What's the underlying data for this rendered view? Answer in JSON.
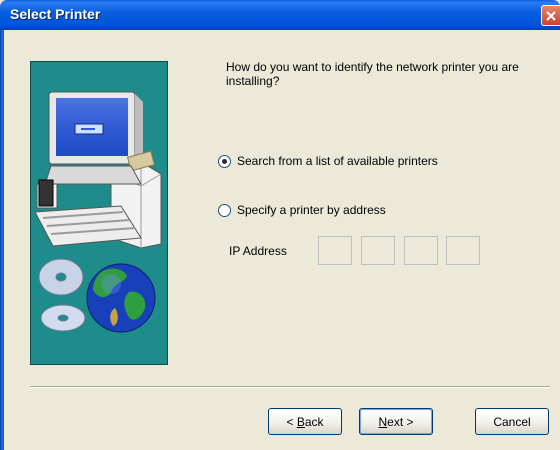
{
  "window": {
    "title": "Select Printer"
  },
  "wizard": {
    "question": "How do you want to identify the network printer you are installing?",
    "options": [
      {
        "label": "Search from a list of available printers",
        "selected": true
      },
      {
        "label": "Specify a printer by address",
        "selected": false
      }
    ],
    "ip_address": {
      "label": "IP Address",
      "octets": [
        "",
        "",
        "",
        ""
      ]
    }
  },
  "buttons": {
    "back": {
      "prefix": "< ",
      "mnemonic": "B",
      "rest": "ack"
    },
    "next": {
      "mnemonic": "N",
      "rest": "ext >"
    },
    "cancel": {
      "label": "Cancel"
    }
  },
  "icons": {
    "close": "close-icon",
    "illustration": "computer-globe-illustration"
  },
  "colors": {
    "titlebar": "#0A5FE0",
    "dialog_bg": "#ECE9D8",
    "illustration_bg": "#1E8C8A",
    "close_button": "#C8452A"
  }
}
